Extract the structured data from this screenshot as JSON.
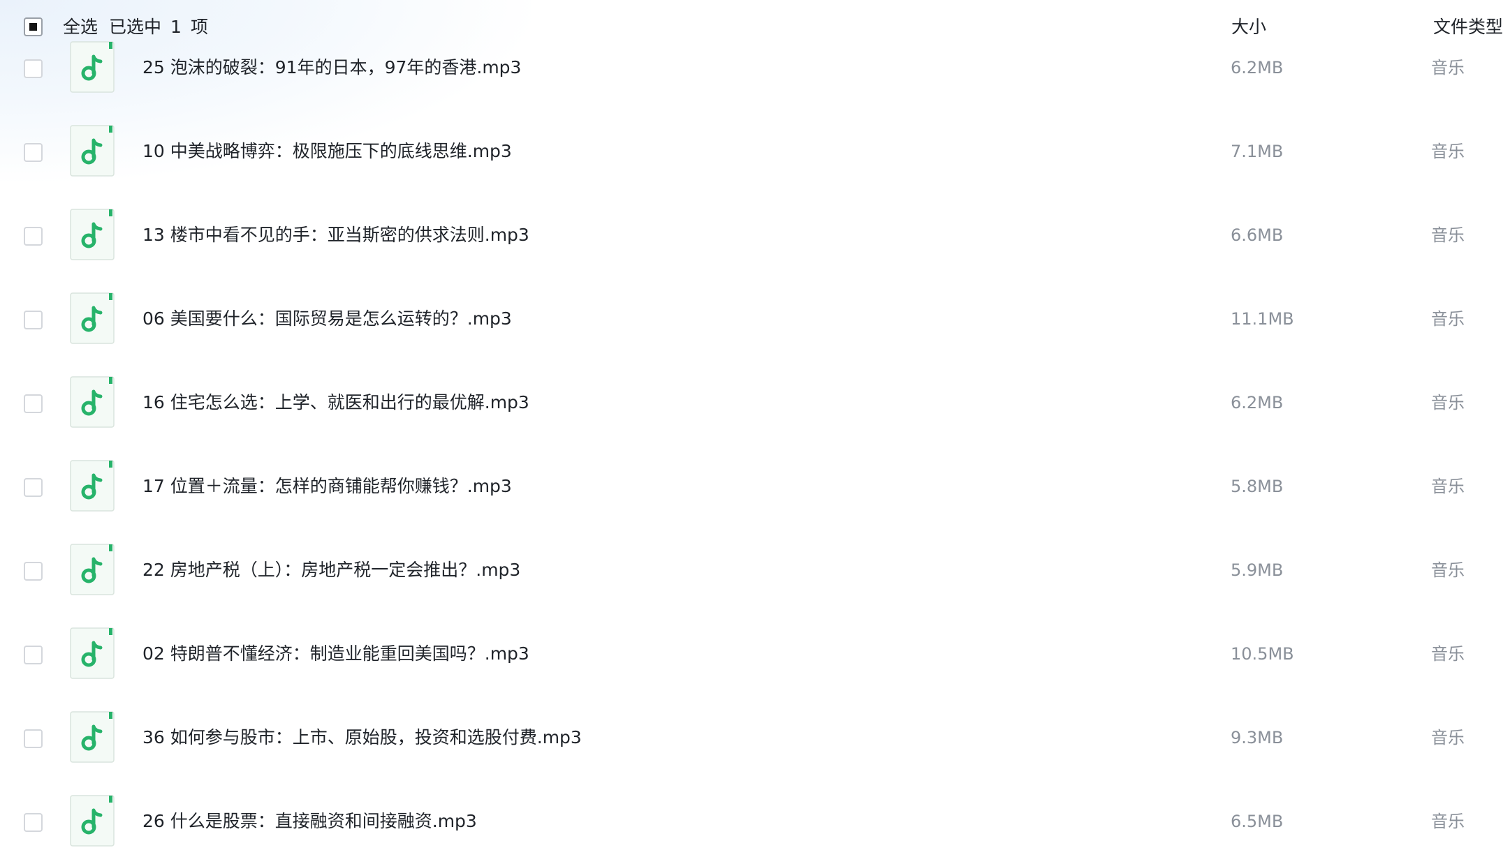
{
  "header": {
    "select_all_label": "全选",
    "selected_prefix": "已选中",
    "selected_count": "1",
    "selected_suffix": "项",
    "column_size": "大小",
    "column_type": "文件类型"
  },
  "colors": {
    "icon_green": "#27b36a",
    "icon_bg": "#f4faf6",
    "text_primary": "#1f2329",
    "text_secondary": "#8a9099"
  },
  "files": [
    {
      "name": "25 泡沫的破裂：91年的日本，97年的香港.mp3",
      "size": "6.2MB",
      "type": "音乐",
      "icon": "music-note-icon",
      "checked": false
    },
    {
      "name": "10 中美战略博弈：极限施压下的底线思维.mp3",
      "size": "7.1MB",
      "type": "音乐",
      "icon": "music-note-icon",
      "checked": false
    },
    {
      "name": "13 楼市中看不见的手：亚当斯密的供求法则.mp3",
      "size": "6.6MB",
      "type": "音乐",
      "icon": "music-note-icon",
      "checked": false
    },
    {
      "name": "06 美国要什么：国际贸易是怎么运转的？.mp3",
      "size": "11.1MB",
      "type": "音乐",
      "icon": "music-note-icon",
      "checked": false
    },
    {
      "name": "16 住宅怎么选：上学、就医和出行的最优解.mp3",
      "size": "6.2MB",
      "type": "音乐",
      "icon": "music-note-icon",
      "checked": false
    },
    {
      "name": "17 位置＋流量：怎样的商铺能帮你赚钱？.mp3",
      "size": "5.8MB",
      "type": "音乐",
      "icon": "music-note-icon",
      "checked": false
    },
    {
      "name": "22 房地产税（上）：房地产税一定会推出？.mp3",
      "size": "5.9MB",
      "type": "音乐",
      "icon": "music-note-icon",
      "checked": false
    },
    {
      "name": "02 特朗普不懂经济：制造业能重回美国吗？.mp3",
      "size": "10.5MB",
      "type": "音乐",
      "icon": "music-note-icon",
      "checked": false
    },
    {
      "name": "36 如何参与股市：上市、原始股，投资和选股付费.mp3",
      "size": "9.3MB",
      "type": "音乐",
      "icon": "music-note-icon",
      "checked": false
    },
    {
      "name": "26 什么是股票：直接融资和间接融资.mp3",
      "size": "6.5MB",
      "type": "音乐",
      "icon": "music-note-icon",
      "checked": false
    }
  ]
}
